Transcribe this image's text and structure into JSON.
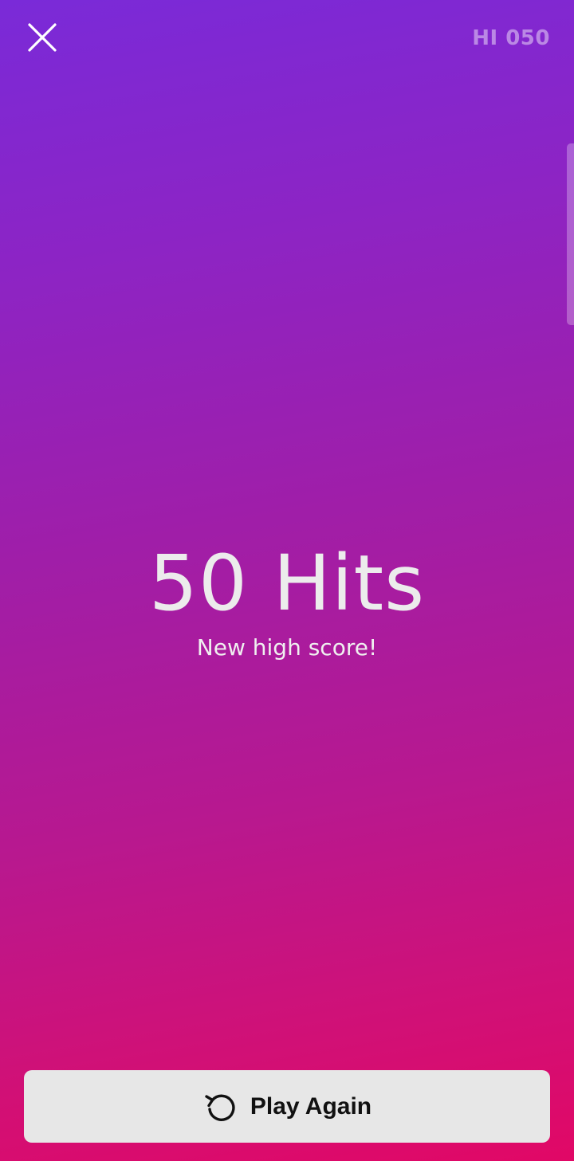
{
  "header": {
    "close_icon": "close-icon",
    "hi_score_text": "HI 050"
  },
  "result": {
    "score_text": "50 Hits",
    "message": "New high score!"
  },
  "actions": {
    "play_again_label": "Play Again",
    "play_again_icon": "replay-icon"
  },
  "colors": {
    "gradient_top": "#7a2ad8",
    "gradient_bottom": "#e10866",
    "button_bg": "#e7e7e7"
  }
}
